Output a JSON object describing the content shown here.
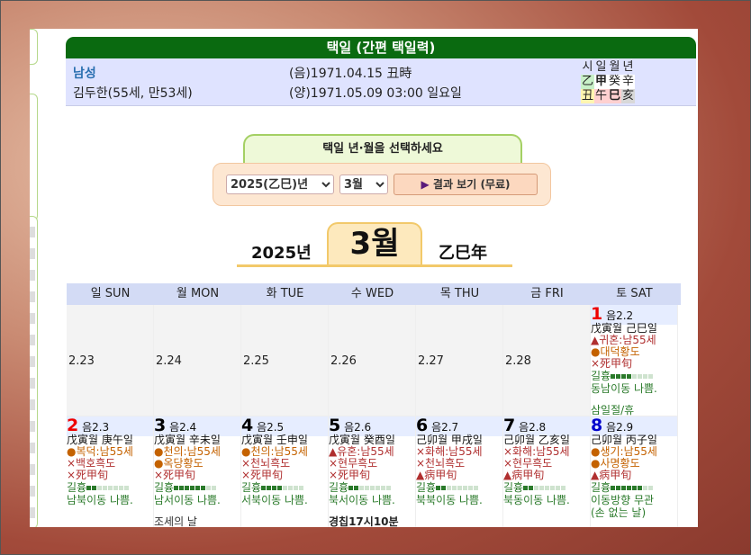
{
  "title": "택일 (간편 택일력)",
  "person": {
    "gender": "남성",
    "name": "김두한(55세, 만53세)",
    "lunar": "(음)1971.04.15 丑時",
    "solar": "(양)1971.05.09 03:00 일요일"
  },
  "pillars": {
    "headers": [
      "시",
      "일",
      "월",
      "년"
    ],
    "stems": [
      "乙",
      "甲",
      "癸",
      "辛"
    ],
    "branches": [
      "丑",
      "午",
      "巳",
      "亥"
    ],
    "stem_colors": [
      "#c8f0c8",
      "#ffffff",
      "#ffffff",
      "#ffffff"
    ],
    "branch_colors": [
      "#fff5b0",
      "#ffd0d0",
      "#ffd0d0",
      "#d8d8d8"
    ]
  },
  "selector": {
    "heading": "택일 년·월을 선택하세요",
    "year_value": "2025(乙巳)년",
    "month_value": "3월",
    "button_label": "결과 보기 (무료)"
  },
  "month": {
    "year": "2025년",
    "label": "3월",
    "ganzhi": "乙巳年"
  },
  "weekdays": [
    "일 SUN",
    "월 MON",
    "화 TUE",
    "수 WED",
    "목 THU",
    "금 FRI",
    "토 SAT"
  ],
  "week1": {
    "prev": [
      "2.23",
      "2.24",
      "2.25",
      "2.26",
      "2.27",
      "2.28"
    ],
    "sat": {
      "num": "1",
      "lunar": "음2.2",
      "gz": "戊寅월 己巳일",
      "gods": [
        "▲귀혼:남55세",
        "●대덕황도",
        "×死甲旬"
      ],
      "luck": "길흉",
      "luck_level": 0.67,
      "move": "동남이동 나쁨.",
      "extra": "삼일절/휴"
    }
  },
  "week2": [
    {
      "num": "2",
      "color": "red",
      "lunar": "음2.3",
      "gz": "戊寅월 庚午일",
      "gods": [
        "●복덕:남55세",
        "×백호흑도",
        "×死甲旬"
      ],
      "luck": "길흉",
      "luck_level": 0.33,
      "move": "남북이동 나쁨.",
      "extra": ""
    },
    {
      "num": "3",
      "color": "black",
      "lunar": "음2.4",
      "gz": "戊寅월 辛未일",
      "gods": [
        "●천의:남55세",
        "●옥당황도",
        "×死甲旬"
      ],
      "luck": "길흉",
      "luck_level": 1.0,
      "move": "남서이동 나쁨.",
      "extra": "조세의 날"
    },
    {
      "num": "4",
      "color": "black",
      "lunar": "음2.5",
      "gz": "戊寅월 壬申일",
      "gods": [
        "●천의:남55세",
        "×천뇌흑도",
        "×死甲旬"
      ],
      "luck": "길흉",
      "luck_level": 0.67,
      "move": "서북이동 나쁨.",
      "extra": ""
    },
    {
      "num": "5",
      "color": "black",
      "lunar": "음2.6",
      "gz": "戊寅월 癸酉일",
      "gods": [
        "▲유혼:남55세",
        "×현무흑도",
        "×死甲旬"
      ],
      "luck": "길흉",
      "luck_level": 0.33,
      "move": "북서이동 나쁨.",
      "extra": "경칩17시10분"
    },
    {
      "num": "6",
      "color": "black",
      "lunar": "음2.7",
      "gz": "己卯월 甲戌일",
      "gods": [
        "×화해:남55세",
        "×천뇌흑도",
        "▲病甲旬"
      ],
      "luck": "길흉",
      "luck_level": 0.33,
      "move": "북북이동 나쁨.",
      "extra": ""
    },
    {
      "num": "7",
      "color": "black",
      "lunar": "음2.8",
      "gz": "己卯월 乙亥일",
      "gods": [
        "×화해:남55세",
        "×현무흑도",
        "▲病甲旬"
      ],
      "luck": "길흉",
      "luck_level": 0.33,
      "move": "북동이동 나쁨.",
      "extra": ""
    },
    {
      "num": "8",
      "color": "blue",
      "lunar": "음2.9",
      "gz": "己卯월 丙子일",
      "gods": [
        "●생기:남55세",
        "●사명황도",
        "▲病甲旬"
      ],
      "luck": "길흉",
      "luck_level": 1.0,
      "move": "이동방향 무관",
      "move2": "(손 없는 날)",
      "extra": ""
    }
  ]
}
